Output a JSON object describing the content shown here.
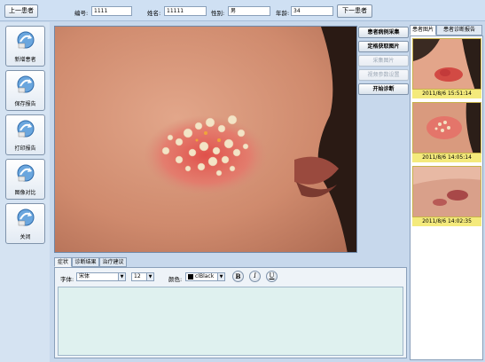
{
  "topbar": {
    "prev_patient": "上一患者",
    "next_patient": "下一患者",
    "fields": {
      "id_label": "编号:",
      "id_value": "1111",
      "name_label": "姓名:",
      "name_value": "11111",
      "gender_label": "性别:",
      "gender_value": "男",
      "age_label": "年龄:",
      "age_value": "34"
    }
  },
  "sidebar": {
    "items": [
      {
        "label": "新增患者",
        "icon": "add-patient-icon"
      },
      {
        "label": "保存报告",
        "icon": "save-report-icon"
      },
      {
        "label": "打印报告",
        "icon": "print-report-icon"
      },
      {
        "label": "图像对比",
        "icon": "compare-images-icon"
      },
      {
        "label": "关闭",
        "icon": "close-icon"
      }
    ]
  },
  "actions": {
    "collect_case": "患者病例采集",
    "fixed_capture": "定格获取图片",
    "capture_image": "采集图片",
    "template_settings": "视频参数设置",
    "start_diagnosis": "开始诊断"
  },
  "right_panel": {
    "tabs": [
      "患者图片",
      "患者诊断报告"
    ],
    "active_tab": 0,
    "thumbnails": [
      {
        "timestamp": "2011/8/6 15:51:14"
      },
      {
        "timestamp": "2011/8/6 14:05:14"
      },
      {
        "timestamp": "2011/8/6 14:02:35"
      }
    ]
  },
  "editor": {
    "tabs": [
      "症状",
      "诊断结果",
      "治疗建议"
    ],
    "active_tab": 0,
    "font_label": "字体:",
    "font_value": "宋体",
    "size_value": "12",
    "color_label": "颜色:",
    "color_value": "clBlack",
    "bold_label": "B",
    "italic_label": "I",
    "underline_label": "U",
    "body_text": ""
  },
  "colors": {
    "background": "#c7d8ec",
    "caption_bg": "#f4ea7c",
    "textarea_bg": "#dff1ef"
  }
}
